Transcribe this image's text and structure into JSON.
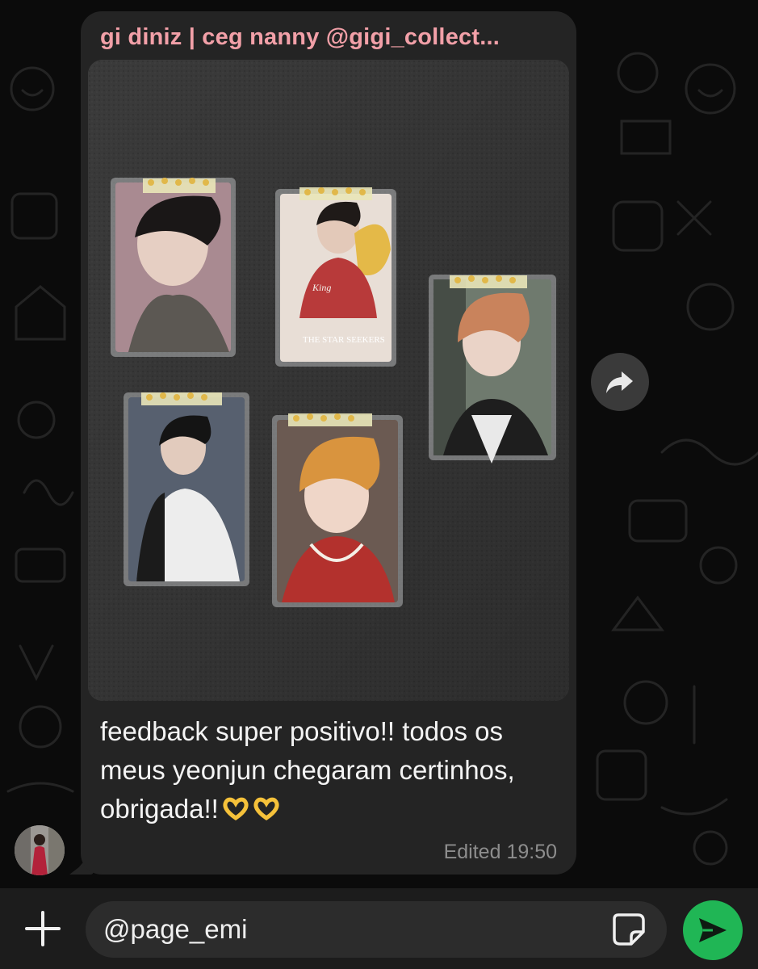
{
  "message": {
    "sender": "gi diniz | ceg nanny @gigi_collect...",
    "caption": "feedback super positivo!! todos os meus yeonjun chegaram certinhos, obrigada!!",
    "caption_emojis": [
      "heart-hands-emoji",
      "heart-hands-emoji"
    ],
    "edited_label": "Edited",
    "time": "19:50",
    "photo": {
      "description_icon": "photo-of-five-photocards",
      "card_texts": [
        "THE STAR SEEKERS",
        "King"
      ]
    }
  },
  "composer": {
    "input_value": "@page_emi",
    "add_icon": "plus-icon",
    "sticker_icon": "sticker-icon",
    "send_icon": "send-icon"
  },
  "actions": {
    "forward_icon": "forward-icon"
  },
  "colors": {
    "sender_name": "#f2a0a8",
    "bubble": "#242424",
    "send_button": "#20b655",
    "background": "#0b0b0b"
  }
}
